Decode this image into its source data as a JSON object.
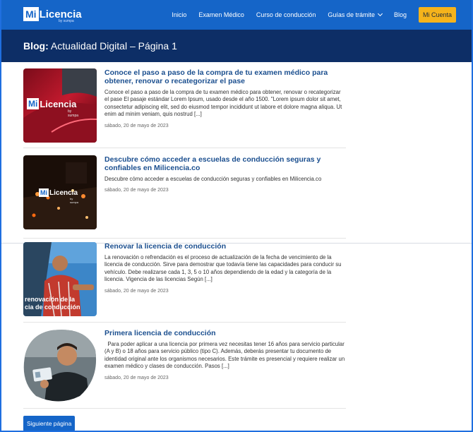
{
  "nav": {
    "logo_mi": "Mi",
    "logo_licencia": "Licencia",
    "logo_sub": "by sumpa",
    "links": [
      "Inicio",
      "Examen Médico",
      "Curso de conducción",
      "Guías de trámite",
      "Blog"
    ],
    "account": "Mi Cuenta",
    "colors": {
      "nav_bg": "#1565c8",
      "account_bg": "#f5b31b"
    }
  },
  "header": {
    "title_prefix": "Blog:",
    "title_rest": "Actualidad Digital – Página 1",
    "bg": "#0d2e66"
  },
  "posts": [
    {
      "title": "Conoce el paso a paso de la compra de tu examen médico para obtener, renovar o recategorizar el pase",
      "excerpt": "Conoce el paso a paso de la compra de tu examen médico para obtener, renovar o recategorizar el pase El pasaje estándar Lorem Ipsum, usado desde el año 1500. \"Lorem ipsum dolor sit amet, consectetur adipiscing elit, sed do eiusmod tempor incididunt ut labore et dolore magna aliqua. Ut enim ad minim veniam, quis nostrud [...]",
      "date": "sábado, 20 de mayo de 2023",
      "thumb_logo_mi": "Mi",
      "thumb_logo_licencia": "Licencia",
      "thumb_logo_sub": "by sumpa"
    },
    {
      "title": "Descubre cómo acceder a escuelas de conducción seguras y confiables en Milicencia.co",
      "excerpt": "Descubre cómo acceder a escuelas de conducción seguras y confiables en Milicencia.co",
      "date": "sábado, 20 de mayo de 2023",
      "thumb_logo_mi": "Mi",
      "thumb_logo_licencia": "Licencia",
      "thumb_logo_sub": "by sumpa"
    },
    {
      "title": "Renovar la licencia de conducción",
      "excerpt": "La renovación o refrendación es el proceso de actualización de la fecha de vencimiento de la licencia de conducción. Sirve para demostrar que todavía tiene las capacidades para conducir su vehículo. Debe realizarse cada 1, 3, 5 o 10 años dependiendo de la edad y la categoría de la licencia. Vigencia de las licencias Según [...]",
      "date": "sábado, 20 de mayo de 2023",
      "thumb_text_1": "renovación de la",
      "thumb_text_2": "cia de conducción"
    },
    {
      "title": "Primera licencia de conducción",
      "excerpt": "  Para poder aplicar a una licencia por primera vez necesitas tener 16 años para servicio particular (A y B) o 18 años para servicio público (tipo C). Además, deberás presentar tu documento de identidad original ante los organismos necesarios. Este trámite es presencial y requiere realizar un examen médico y clases de conducción. Pasos [...]",
      "date": "sábado, 20 de mayo de 2023"
    }
  ],
  "pagination": {
    "next": "Siguiente página"
  }
}
